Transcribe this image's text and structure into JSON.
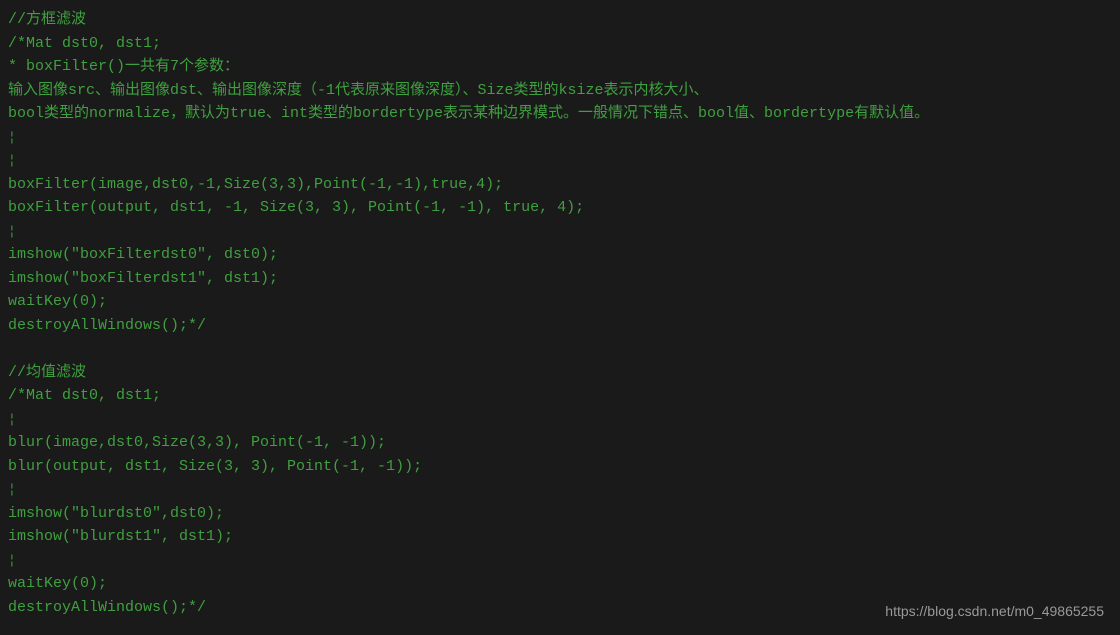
{
  "code": {
    "lines": [
      "//方框滤波",
      "/*Mat dst0, dst1;",
      "* boxFilter()一共有7个参数：",
      "输入图像src、输出图像dst、输出图像深度（-1代表原来图像深度）、Size类型的ksize表示内核大小、",
      "bool类型的normalize，默认为true、int类型的bordertype表示某种边界模式。一般情况下错点、bool值、bordertype有默认值。",
      "¦",
      "¦",
      "boxFilter(image,dst0,-1,Size(3,3),Point(-1,-1),true,4);",
      "boxFilter(output, dst1, -1, Size(3, 3), Point(-1, -1), true, 4);",
      "¦",
      "imshow(\"boxFilterdst0\", dst0);",
      "imshow(\"boxFilterdst1\", dst1);",
      "waitKey(0);",
      "destroyAllWindows();*/",
      "",
      "//均值滤波",
      "/*Mat dst0, dst1;",
      "¦",
      "blur(image,dst0,Size(3,3), Point(-1, -1));",
      "blur(output, dst1, Size(3, 3), Point(-1, -1));",
      "¦",
      "imshow(\"blurdst0\",dst0);",
      "imshow(\"blurdst1\", dst1);",
      "¦",
      "waitKey(0);",
      "destroyAllWindows();*/"
    ]
  },
  "watermark": "https://blog.csdn.net/m0_49865255"
}
